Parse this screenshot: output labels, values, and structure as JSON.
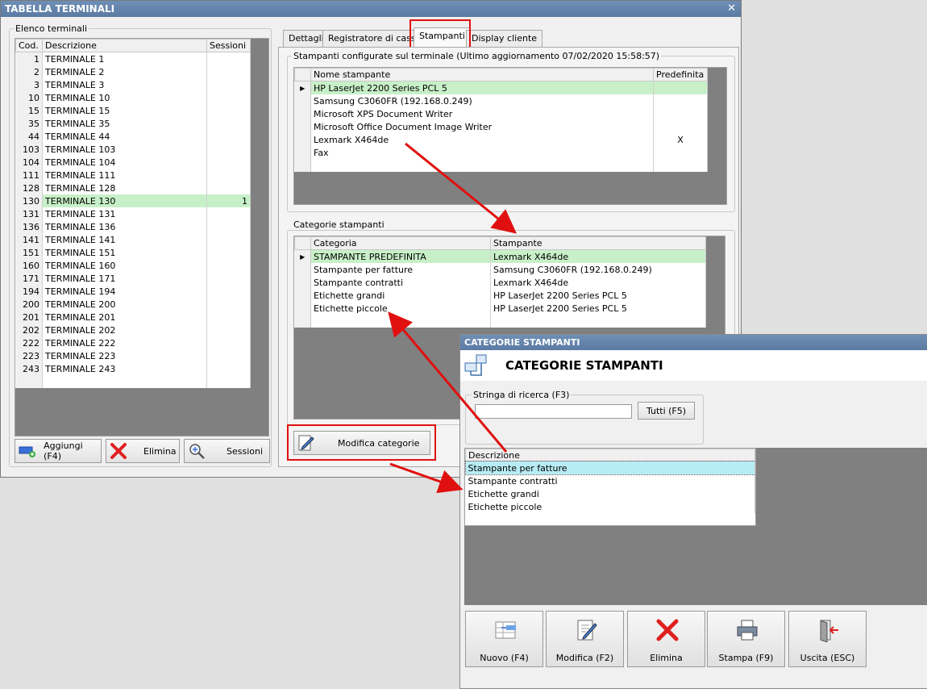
{
  "main_window": {
    "title": "TABELLA TERMINALI",
    "close_glyph": "✕",
    "terminals_group_label": "Elenco terminali",
    "terminals_columns": [
      "Cod.",
      "Descrizione",
      "Sessioni"
    ],
    "terminals": [
      {
        "cod": "1",
        "desc": "TERMINALE 1",
        "sessions": ""
      },
      {
        "cod": "2",
        "desc": "TERMINALE 2",
        "sessions": ""
      },
      {
        "cod": "3",
        "desc": "TERMINALE 3",
        "sessions": ""
      },
      {
        "cod": "10",
        "desc": "TERMINALE 10",
        "sessions": ""
      },
      {
        "cod": "15",
        "desc": "TERMINALE 15",
        "sessions": ""
      },
      {
        "cod": "35",
        "desc": "TERMINALE 35",
        "sessions": ""
      },
      {
        "cod": "44",
        "desc": "TERMINALE 44",
        "sessions": ""
      },
      {
        "cod": "103",
        "desc": "TERMINALE 103",
        "sessions": ""
      },
      {
        "cod": "104",
        "desc": "TERMINALE 104",
        "sessions": ""
      },
      {
        "cod": "111",
        "desc": "TERMINALE 111",
        "sessions": ""
      },
      {
        "cod": "128",
        "desc": "TERMINALE 128",
        "sessions": ""
      },
      {
        "cod": "130",
        "desc": "TERMINALE 130",
        "sessions": "1",
        "selected": true
      },
      {
        "cod": "131",
        "desc": "TERMINALE 131",
        "sessions": ""
      },
      {
        "cod": "136",
        "desc": "TERMINALE 136",
        "sessions": ""
      },
      {
        "cod": "141",
        "desc": "TERMINALE 141",
        "sessions": ""
      },
      {
        "cod": "151",
        "desc": "TERMINALE 151",
        "sessions": ""
      },
      {
        "cod": "160",
        "desc": "TERMINALE 160",
        "sessions": ""
      },
      {
        "cod": "171",
        "desc": "TERMINALE 171",
        "sessions": ""
      },
      {
        "cod": "194",
        "desc": "TERMINALE 194",
        "sessions": ""
      },
      {
        "cod": "200",
        "desc": "TERMINALE 200",
        "sessions": ""
      },
      {
        "cod": "201",
        "desc": "TERMINALE 201",
        "sessions": ""
      },
      {
        "cod": "202",
        "desc": "TERMINALE 202",
        "sessions": ""
      },
      {
        "cod": "222",
        "desc": "TERMINALE 222",
        "sessions": ""
      },
      {
        "cod": "223",
        "desc": "TERMINALE 223",
        "sessions": ""
      },
      {
        "cod": "243",
        "desc": "TERMINALE 243",
        "sessions": ""
      }
    ],
    "buttons": {
      "add": "Aggiungi (F4)",
      "delete": "Elimina",
      "sessions": "Sessioni"
    },
    "tabs": [
      "Dettagli",
      "Registratore di cassa",
      "Stampanti",
      "Display cliente"
    ],
    "active_tab": "Stampanti",
    "printers_group_label": "Stampanti configurate sul terminale (Ultimo aggiornamento 07/02/2020 15:58:57)",
    "printers_columns": [
      "Nome stampante",
      "Predefinita"
    ],
    "printers": [
      {
        "name": "HP LaserJet 2200 Series PCL 5",
        "default": "",
        "selected": true
      },
      {
        "name": "Samsung C3060FR (192.168.0.249)",
        "default": ""
      },
      {
        "name": "Microsoft XPS Document Writer",
        "default": ""
      },
      {
        "name": "Microsoft Office Document Image Writer",
        "default": ""
      },
      {
        "name": "Lexmark X464de",
        "default": "X"
      },
      {
        "name": "Fax",
        "default": ""
      }
    ],
    "categories_group_label": "Categorie stampanti",
    "categories_columns": [
      "Categoria",
      "Stampante"
    ],
    "categories": [
      {
        "category": "STAMPANTE PREDEFINITA",
        "printer": "Lexmark X464de",
        "selected": true
      },
      {
        "category": "Stampante per fatture",
        "printer": "Samsung C3060FR (192.168.0.249)"
      },
      {
        "category": "Stampante contratti",
        "printer": "Lexmark X464de"
      },
      {
        "category": "Etichette grandi",
        "printer": "HP LaserJet 2200 Series PCL 5"
      },
      {
        "category": "Etichette piccole",
        "printer": "HP LaserJet 2200 Series PCL 5"
      }
    ],
    "edit_categories_button": "Modifica categorie"
  },
  "dialog": {
    "title": "CATEGORIE STAMPANTI",
    "header": "CATEGORIE STAMPANTI",
    "search_label": "Stringa di ricerca (F3)",
    "search_value": "",
    "all_button": "Tutti (F5)",
    "list_column": "Descrizione",
    "items": [
      {
        "label": "Stampante per fatture",
        "selected": true
      },
      {
        "label": "Stampante contratti"
      },
      {
        "label": "Etichette grandi"
      },
      {
        "label": "Etichette piccole"
      }
    ],
    "buttons": {
      "new": "Nuovo (F4)",
      "edit": "Modifica (F2)",
      "delete": "Elimina",
      "print": "Stampa (F9)",
      "exit": "Uscita (ESC)"
    }
  },
  "colors": {
    "selection_green": "#c8f0c8",
    "selection_cyan": "#b8ecf4",
    "title_bar": "#6f8fb6",
    "highlight_red": "#e01010"
  }
}
